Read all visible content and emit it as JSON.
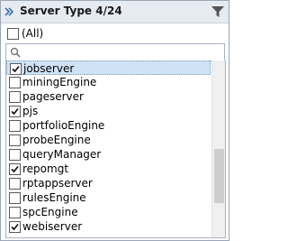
{
  "header": {
    "title": "Server Type 4/24"
  },
  "icons": {
    "collapse": "collapse-x-icon",
    "filter": "funnel-icon",
    "search": "magnifier-icon"
  },
  "all_option": {
    "label": "(All)",
    "checked": false
  },
  "search": {
    "value": "",
    "placeholder": ""
  },
  "items": [
    {
      "label": "jobserver",
      "checked": true,
      "selected": true
    },
    {
      "label": "miningEngine",
      "checked": false,
      "selected": false
    },
    {
      "label": "pageserver",
      "checked": false,
      "selected": false
    },
    {
      "label": "pjs",
      "checked": true,
      "selected": false
    },
    {
      "label": "portfolioEngine",
      "checked": false,
      "selected": false
    },
    {
      "label": "probeEngine",
      "checked": false,
      "selected": false
    },
    {
      "label": "queryManager",
      "checked": false,
      "selected": false
    },
    {
      "label": "repomgt",
      "checked": true,
      "selected": false
    },
    {
      "label": "rptappserver",
      "checked": false,
      "selected": false
    },
    {
      "label": "rulesEngine",
      "checked": false,
      "selected": false
    },
    {
      "label": "spcEngine",
      "checked": false,
      "selected": false
    },
    {
      "label": "webiserver",
      "checked": true,
      "selected": false
    }
  ],
  "scroll_position": 0.72,
  "colors": {
    "header_bg": "#e6ebf1",
    "selected_bg": "#cfe2f6",
    "border": "#9aa7b6"
  }
}
